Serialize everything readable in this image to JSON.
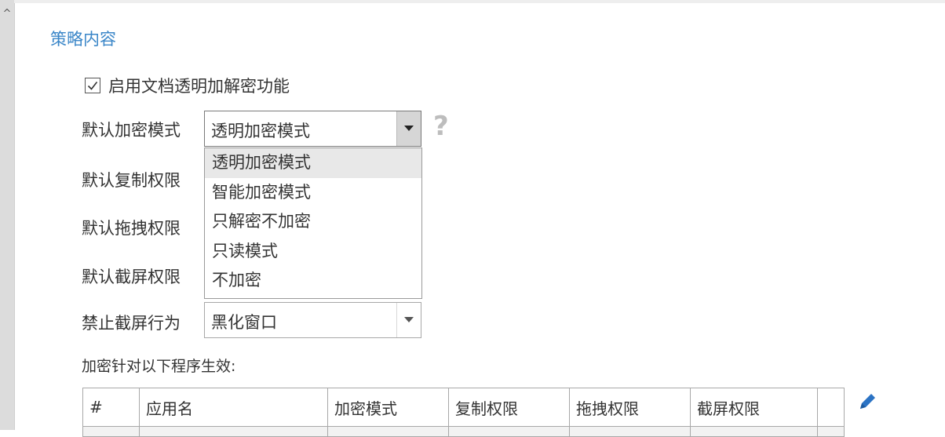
{
  "section_title": "策略内容",
  "enable_option": {
    "label": "启用文档透明加解密功能",
    "checked": true
  },
  "fields": {
    "encrypt_mode": {
      "label": "默认加密模式",
      "value": "透明加密模式",
      "options": [
        "透明加密模式",
        "智能加密模式",
        "只解密不加密",
        "只读模式",
        "不加密"
      ]
    },
    "copy_permission": {
      "label": "默认复制权限"
    },
    "drag_permission": {
      "label": "默认拖拽权限"
    },
    "screenshot_permission": {
      "label": "默认截屏权限"
    },
    "block_screenshot": {
      "label": "禁止截屏行为",
      "value": "黑化窗口"
    }
  },
  "help_icon": "?",
  "table": {
    "caption": "加密针对以下程序生效:",
    "headers": [
      "#",
      "应用名",
      "加密模式",
      "复制权限",
      "拖拽权限",
      "截屏权限",
      ""
    ]
  },
  "icons": {
    "scroll_up": "chevron-up-icon",
    "checkbox": "checkmark-icon",
    "dropdown_arrow": "caret-down-icon",
    "help": "question-mark-icon",
    "edit": "pencil-icon"
  },
  "colors": {
    "title_blue": "#3a86c8",
    "edit_icon_blue": "#2b73c4",
    "selected_option_bg": "#e8e8e8"
  }
}
